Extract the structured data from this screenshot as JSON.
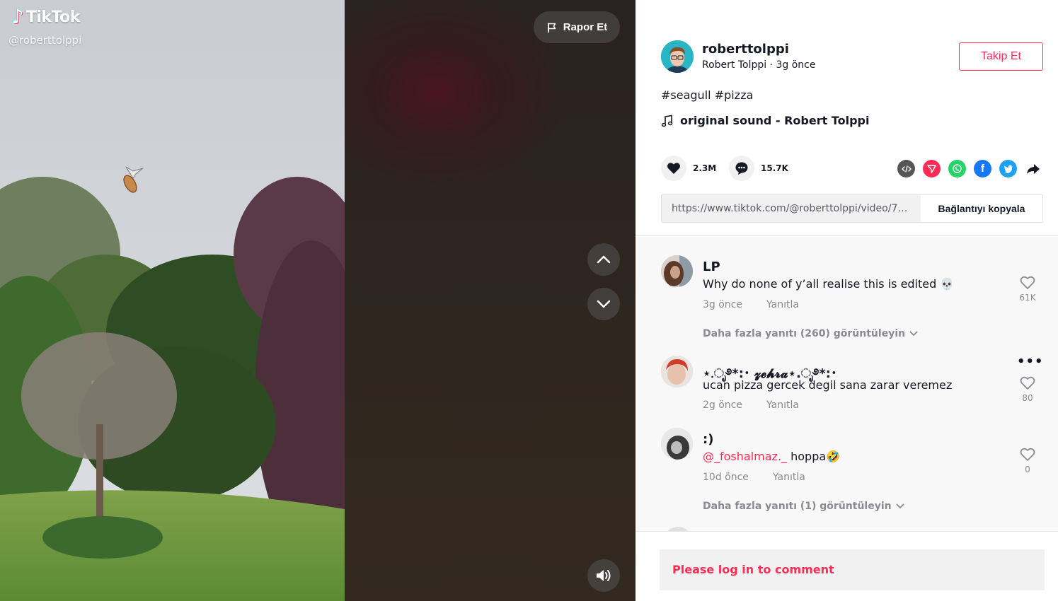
{
  "app": {
    "logo_text": "TikTok",
    "watermark_username": "@roberttolppi"
  },
  "video": {
    "report_label": "Rapor Et",
    "nav_up_icon": "chevron-up-icon",
    "nav_down_icon": "chevron-down-icon",
    "volume_icon": "volume-icon"
  },
  "author": {
    "username": "roberttolppi",
    "subtitle": "Robert Tolppi · 3g önce",
    "follow_label": "Takip Et"
  },
  "post": {
    "caption": "#seagull #pizza",
    "sound": "original sound - Robert Tolppi",
    "likes": "2.3M",
    "comments": "15.7K",
    "share_icons": [
      "embed-icon",
      "send-icon",
      "whatsapp-icon",
      "facebook-icon",
      "twitter-icon",
      "share-arrow-icon"
    ],
    "link_url": "https://www.tiktok.com/@roberttolppi/video/7100...",
    "copy_label": "Bağlantıyı kopyala"
  },
  "comments": [
    {
      "name": "LP",
      "text": "Why do none of y’all realise this is edited 💀",
      "time": "3g önce",
      "reply_label": "Yanıtla",
      "likes": "61K",
      "view_replies": "Daha fazla yanıtı (260) görüntüleyin"
    },
    {
      "name": "⋆.ೃ࿔*:･ 𝔃𝓮𝓱𝓻𝓪⋆.ೃ࿔*:･",
      "text": "ucan pizza gercek degil sana zarar veremez",
      "time": "2g önce",
      "reply_label": "Yanıtla",
      "likes": "80",
      "more_label": "•••"
    },
    {
      "name": ":)",
      "mention": "@_foshalmaz._",
      "text": " hoppa🤣",
      "time": "10d önce",
      "reply_label": "Yanıtla",
      "likes": "0",
      "view_replies": "Daha fazla yanıtı (1) görüntüleyin"
    }
  ],
  "login_prompt": "Please log in to comment",
  "colors": {
    "accent": "#fe2c55",
    "text": "#161823",
    "muted": "#8a8b91",
    "panel_bg": "#f8f8f8"
  }
}
